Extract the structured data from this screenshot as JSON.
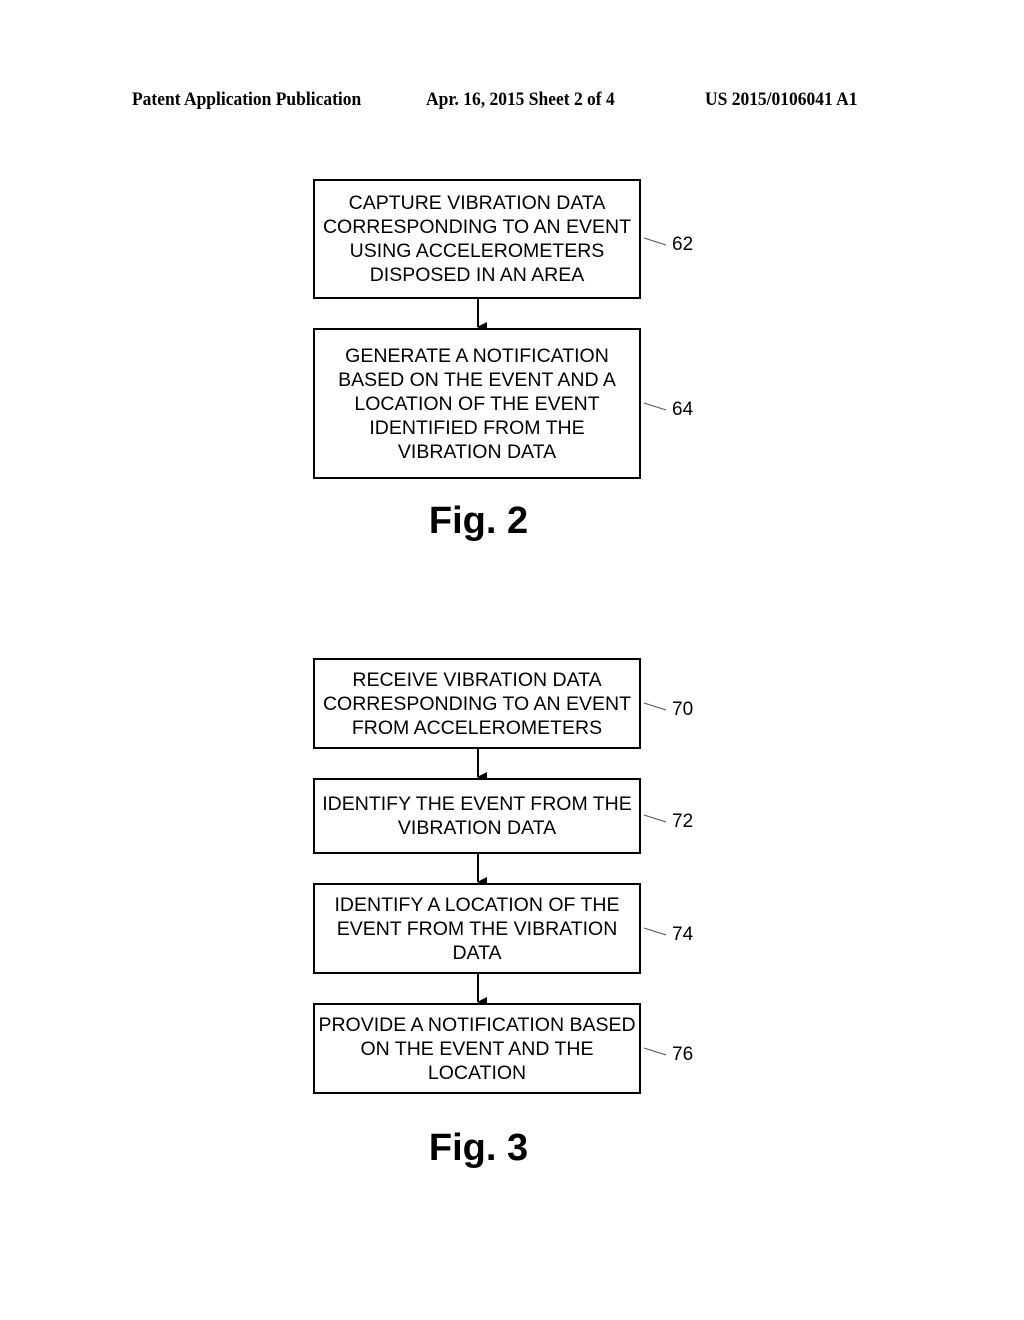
{
  "header": {
    "publication": "Patent Application Publication",
    "date_sheet": "Apr. 16, 2015  Sheet 2 of 4",
    "number": "US 2015/0106041 A1"
  },
  "fig2": {
    "label": "Fig. 2",
    "steps": [
      {
        "text": "CAPTURE VIBRATION DATA CORRESPONDING TO AN EVENT USING ACCELEROMETERS DISPOSED IN AN AREA",
        "ref": "62"
      },
      {
        "text": "GENERATE A NOTIFICATION BASED ON THE EVENT AND A LOCATION OF THE EVENT IDENTIFIED FROM THE VIBRATION DATA",
        "ref": "64"
      }
    ]
  },
  "fig3": {
    "label": "Fig. 3",
    "steps": [
      {
        "text": "RECEIVE VIBRATION DATA CORRESPONDING TO AN EVENT FROM ACCELEROMETERS",
        "ref": "70"
      },
      {
        "text": "IDENTIFY THE EVENT FROM THE VIBRATION DATA",
        "ref": "72"
      },
      {
        "text": "IDENTIFY A LOCATION OF THE EVENT FROM THE VIBRATION DATA",
        "ref": "74"
      },
      {
        "text": "PROVIDE A NOTIFICATION BASED ON THE EVENT AND THE LOCATION",
        "ref": "76"
      }
    ]
  }
}
